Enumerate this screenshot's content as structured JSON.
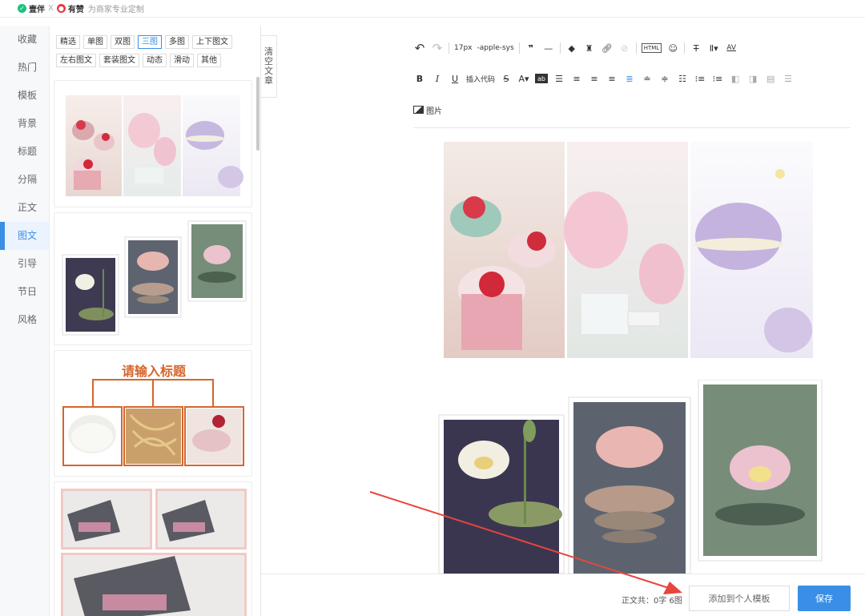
{
  "brand": {
    "name1": "壹伴",
    "separator": "X",
    "name2": "有赞",
    "slogan": "为商家专业定制",
    "color1": "#19c37d",
    "color2": "#e4393c"
  },
  "categories": [
    "收藏",
    "热门",
    "模板",
    "背景",
    "标题",
    "分隔",
    "正文",
    "图文",
    "引导",
    "节日",
    "风格"
  ],
  "active_category": "图文",
  "filter_tags_row1": [
    "精选",
    "单图",
    "双图",
    "三图",
    "多图",
    "上下图文"
  ],
  "filter_tags_row2": [
    "左右图文",
    "套装图文",
    "动态",
    "滑动",
    "其他"
  ],
  "active_filter": "三图",
  "clear_article": [
    "清",
    "空",
    "文",
    "章"
  ],
  "cards": {
    "title_template": "请输入标题"
  },
  "toolbar": {
    "font_size": "17px",
    "font_family": "-apple-sys",
    "insert_code": "插入代码",
    "image_label": "图片",
    "html_label": "HTML",
    "av_label": "AV"
  },
  "footer": {
    "count_text": "正文共：0字 6图",
    "add_template": "添加到个人模板",
    "save": "保存"
  },
  "colors": {
    "accent": "#3a8ee6",
    "title_orange": "#d5652b",
    "annotation_arrow": "#e8453c"
  }
}
